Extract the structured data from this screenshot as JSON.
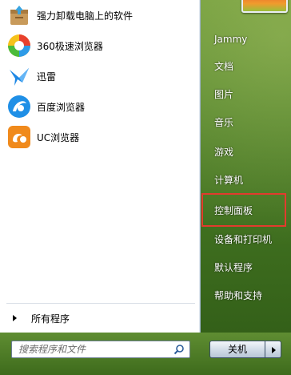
{
  "programs": [
    {
      "label": "强力卸载电脑上的软件",
      "icon": "uninstall-box-icon"
    },
    {
      "label": "360极速浏览器",
      "icon": "360-browser-icon"
    },
    {
      "label": "迅雷",
      "icon": "xunlei-bird-icon"
    },
    {
      "label": "百度浏览器",
      "icon": "baidu-browser-icon"
    },
    {
      "label": "UC浏览器",
      "icon": "uc-browser-icon"
    }
  ],
  "all_programs_label": "所有程序",
  "search": {
    "placeholder": "搜索程序和文件"
  },
  "right_menu": {
    "user": "Jammy",
    "documents": "文档",
    "pictures": "图片",
    "music": "音乐",
    "games": "游戏",
    "computer": "计算机",
    "control_panel": "控制面板",
    "devices_printers": "设备和打印机",
    "default_programs": "默认程序",
    "help_support": "帮助和支持"
  },
  "shutdown_label": "关机",
  "colors": {
    "highlight": "#e23b2e",
    "right_pane": "#4c7a23"
  }
}
